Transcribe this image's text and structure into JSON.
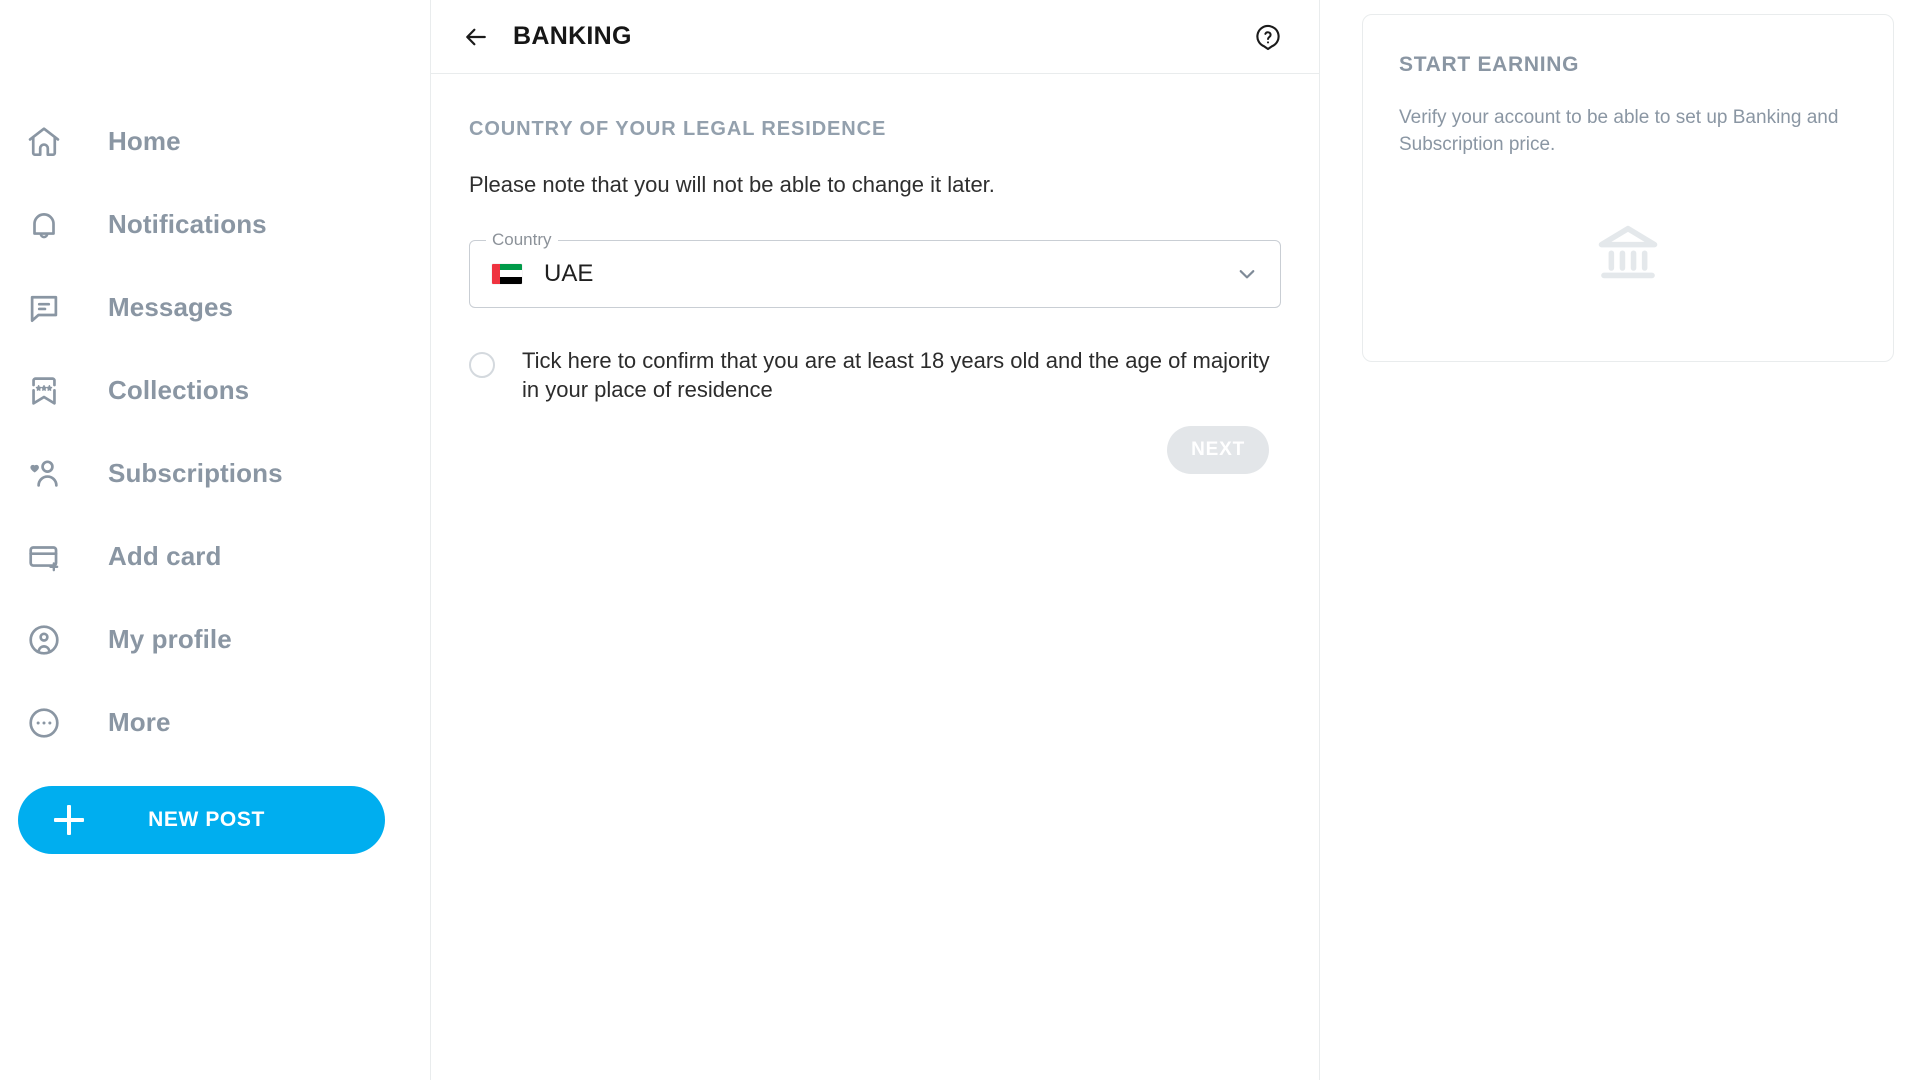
{
  "sidebar": {
    "items": [
      {
        "label": "Home",
        "icon": "home-icon"
      },
      {
        "label": "Notifications",
        "icon": "bell-icon"
      },
      {
        "label": "Messages",
        "icon": "message-icon"
      },
      {
        "label": "Collections",
        "icon": "bookmark-stars-icon"
      },
      {
        "label": "Subscriptions",
        "icon": "person-heart-icon"
      },
      {
        "label": "Add card",
        "icon": "credit-card-plus-icon"
      },
      {
        "label": "My profile",
        "icon": "user-circle-icon"
      },
      {
        "label": "More",
        "icon": "ellipsis-circle-icon"
      }
    ],
    "new_post": {
      "label": "NEW POST",
      "icon": "plus-icon",
      "color": "#00aeef"
    }
  },
  "main": {
    "header": {
      "back_icon": "arrow-left-icon",
      "title": "BANKING",
      "help_icon": "help-question-icon"
    },
    "section_label": "COUNTRY OF YOUR LEGAL RESIDENCE",
    "note": "Please note that you will not be able to change it later.",
    "country_field": {
      "legend": "Country",
      "value": "UAE",
      "flag": "uae-flag-icon",
      "chevron_icon": "chevron-down-icon"
    },
    "age_confirm": {
      "checked": false,
      "text": "Tick here to confirm that you are at least 18 years old and the age of majority in your place of residence"
    },
    "next_button": {
      "label": "NEXT",
      "disabled": true,
      "bg": "#e3e6e9"
    }
  },
  "right_panel": {
    "card": {
      "title": "START EARNING",
      "description": "Verify your account to be able to set up Banking and Subscription price.",
      "icon": "bank-building-icon"
    }
  }
}
